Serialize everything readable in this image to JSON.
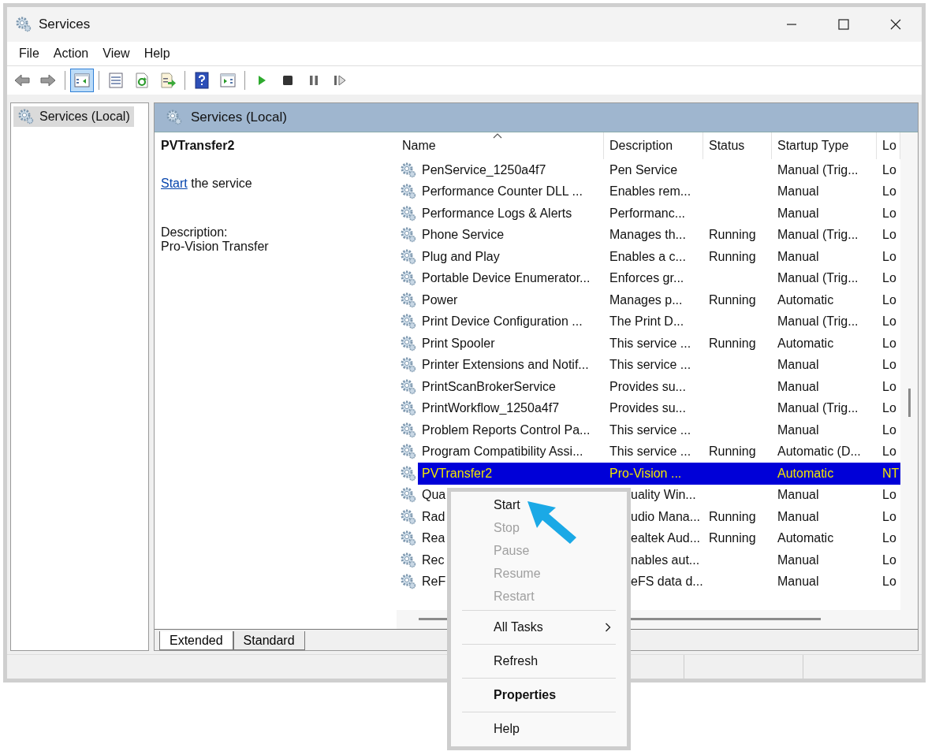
{
  "window": {
    "title": "Services"
  },
  "menu_bar": [
    "File",
    "Action",
    "View",
    "Help"
  ],
  "toolbar": [
    [
      {
        "kind": "back",
        "pressed": false
      },
      {
        "kind": "forward",
        "pressed": false
      }
    ],
    [
      {
        "kind": "console-tree",
        "pressed": true
      }
    ],
    [
      {
        "kind": "properties",
        "pressed": false
      },
      {
        "kind": "refresh",
        "pressed": false
      },
      {
        "kind": "export",
        "pressed": false
      }
    ],
    [
      {
        "kind": "help",
        "pressed": false
      },
      {
        "kind": "action-pane",
        "pressed": false
      }
    ],
    [
      {
        "kind": "start",
        "pressed": false
      },
      {
        "kind": "stop",
        "pressed": false
      },
      {
        "kind": "pause",
        "pressed": false
      },
      {
        "kind": "resume",
        "pressed": false
      }
    ]
  ],
  "tree": {
    "items": [
      {
        "label": "Services (Local)",
        "selected": true
      }
    ]
  },
  "pane_header": "Services (Local)",
  "details": {
    "service_name": "PVTransfer2",
    "action_link": "Start",
    "action_text": "the service",
    "description_label": "Description:",
    "description": "Pro-Vision Transfer"
  },
  "table": {
    "columns": [
      {
        "label": "Name",
        "sorted": true
      },
      {
        "label": "Description",
        "sorted": false
      },
      {
        "label": "Status",
        "sorted": false
      },
      {
        "label": "Startup Type",
        "sorted": false
      },
      {
        "label": "Lo",
        "sorted": false
      }
    ],
    "rows": [
      {
        "name": "PenService_1250a4f7",
        "description": "Pen Service",
        "status": "",
        "startup_type": "Manual (Trig...",
        "log_on_as": "Lo",
        "selected": false
      },
      {
        "name": "Performance Counter DLL ...",
        "description": "Enables rem...",
        "status": "",
        "startup_type": "Manual",
        "log_on_as": "Lo",
        "selected": false
      },
      {
        "name": "Performance Logs & Alerts",
        "description": "Performanc...",
        "status": "",
        "startup_type": "Manual",
        "log_on_as": "Lo",
        "selected": false
      },
      {
        "name": "Phone Service",
        "description": "Manages th...",
        "status": "Running",
        "startup_type": "Manual (Trig...",
        "log_on_as": "Lo",
        "selected": false
      },
      {
        "name": "Plug and Play",
        "description": "Enables a c...",
        "status": "Running",
        "startup_type": "Manual",
        "log_on_as": "Lo",
        "selected": false
      },
      {
        "name": "Portable Device Enumerator...",
        "description": "Enforces gr...",
        "status": "",
        "startup_type": "Manual (Trig...",
        "log_on_as": "Lo",
        "selected": false
      },
      {
        "name": "Power",
        "description": "Manages p...",
        "status": "Running",
        "startup_type": "Automatic",
        "log_on_as": "Lo",
        "selected": false
      },
      {
        "name": "Print Device Configuration ...",
        "description": "The Print D...",
        "status": "",
        "startup_type": "Manual (Trig...",
        "log_on_as": "Lo",
        "selected": false
      },
      {
        "name": "Print Spooler",
        "description": "This service ...",
        "status": "Running",
        "startup_type": "Automatic",
        "log_on_as": "Lo",
        "selected": false
      },
      {
        "name": "Printer Extensions and Notif...",
        "description": "This service ...",
        "status": "",
        "startup_type": "Manual",
        "log_on_as": "Lo",
        "selected": false
      },
      {
        "name": "PrintScanBrokerService",
        "description": "Provides su...",
        "status": "",
        "startup_type": "Manual",
        "log_on_as": "Lo",
        "selected": false
      },
      {
        "name": "PrintWorkflow_1250a4f7",
        "description": "Provides su...",
        "status": "",
        "startup_type": "Manual (Trig...",
        "log_on_as": "Lo",
        "selected": false
      },
      {
        "name": "Problem Reports Control Pa...",
        "description": "This service ...",
        "status": "",
        "startup_type": "Manual",
        "log_on_as": "Lo",
        "selected": false
      },
      {
        "name": "Program Compatibility Assi...",
        "description": "This service ...",
        "status": "Running",
        "startup_type": "Automatic (D...",
        "log_on_as": "Lo",
        "selected": false
      },
      {
        "name": "PVTransfer2",
        "description": "Pro-Vision ...",
        "status": "",
        "startup_type": "Automatic",
        "log_on_as": "NT",
        "selected": true
      },
      {
        "name": "Qua",
        "description": "uality Win...",
        "status": "",
        "startup_type": "Manual",
        "log_on_as": "Lo",
        "selected": false
      },
      {
        "name": "Rad",
        "description": "udio Mana...",
        "status": "Running",
        "startup_type": "Manual",
        "log_on_as": "Lo",
        "selected": false
      },
      {
        "name": "Rea",
        "description": "ealtek Aud...",
        "status": "Running",
        "startup_type": "Automatic",
        "log_on_as": "Lo",
        "selected": false
      },
      {
        "name": "Rec",
        "description": "nables aut...",
        "status": "",
        "startup_type": "Manual",
        "log_on_as": "Lo",
        "selected": false
      },
      {
        "name": "ReF",
        "description": "eFS data d...",
        "status": "",
        "startup_type": "Manual",
        "log_on_as": "Lo",
        "selected": false
      }
    ]
  },
  "tabs": [
    {
      "label": "Extended",
      "selected": true
    },
    {
      "label": "Standard",
      "selected": false
    }
  ],
  "context_menu": {
    "groups": [
      [
        {
          "label": "Start",
          "disabled": false,
          "submenu": false,
          "default": false
        },
        {
          "label": "Stop",
          "disabled": true,
          "submenu": false,
          "default": false
        },
        {
          "label": "Pause",
          "disabled": true,
          "submenu": false,
          "default": false
        },
        {
          "label": "Resume",
          "disabled": true,
          "submenu": false,
          "default": false
        },
        {
          "label": "Restart",
          "disabled": true,
          "submenu": false,
          "default": false
        }
      ],
      [
        {
          "label": "All Tasks",
          "disabled": false,
          "submenu": true,
          "default": false
        }
      ],
      [
        {
          "label": "Refresh",
          "disabled": false,
          "submenu": false,
          "default": false
        }
      ],
      [
        {
          "label": "Properties",
          "disabled": false,
          "submenu": false,
          "default": true
        }
      ],
      [
        {
          "label": "Help",
          "disabled": false,
          "submenu": false,
          "default": false
        }
      ]
    ]
  }
}
